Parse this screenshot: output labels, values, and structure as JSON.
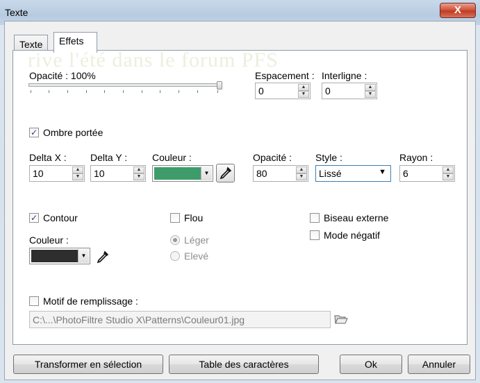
{
  "window": {
    "title": "Texte",
    "close_glyph": "X"
  },
  "tabs": [
    {
      "label": "Texte",
      "active": false
    },
    {
      "label": "Effets",
      "active": true
    }
  ],
  "watermark": "rive l'été dans le forum PFS",
  "opacity_slider": {
    "label": "Opacité : 100%",
    "value_percent": 100
  },
  "spacing": {
    "label": "Espacement :",
    "value": "0"
  },
  "line_spacing": {
    "label": "Interligne :",
    "value": "0"
  },
  "shadow": {
    "label": "Ombre portée",
    "checked": true,
    "delta_x": {
      "label": "Delta X :",
      "value": "10"
    },
    "delta_y": {
      "label": "Delta Y :",
      "value": "10"
    },
    "color": {
      "label": "Couleur :",
      "value": "#3e9c6a"
    },
    "opacity": {
      "label": "Opacité :",
      "value": "80"
    },
    "style": {
      "label": "Style :",
      "value": "Lissé"
    },
    "radius": {
      "label": "Rayon :",
      "value": "6"
    }
  },
  "outline": {
    "label": "Contour",
    "checked": true,
    "color_label": "Couleur :",
    "color": "#2e2e2e"
  },
  "blur": {
    "label": "Flou",
    "checked": false,
    "options": [
      {
        "label": "Léger",
        "selected": true
      },
      {
        "label": "Elevé",
        "selected": false
      }
    ]
  },
  "bevel": {
    "label": "Biseau externe",
    "checked": false
  },
  "negative": {
    "label": "Mode négatif",
    "checked": false
  },
  "pattern": {
    "label": "Motif de remplissage :",
    "checked": false,
    "path": "C:\\...\\PhotoFiltre Studio X\\Patterns\\Couleur01.jpg"
  },
  "buttons": {
    "to_selection": "Transformer en sélection",
    "char_table": "Table des caractères",
    "ok": "Ok",
    "cancel": "Annuler"
  },
  "icons": {
    "eyedropper": "eyedropper-icon",
    "folder": "folder-open-icon",
    "check": "✓",
    "arrow_up": "▲",
    "arrow_down": "▼"
  }
}
